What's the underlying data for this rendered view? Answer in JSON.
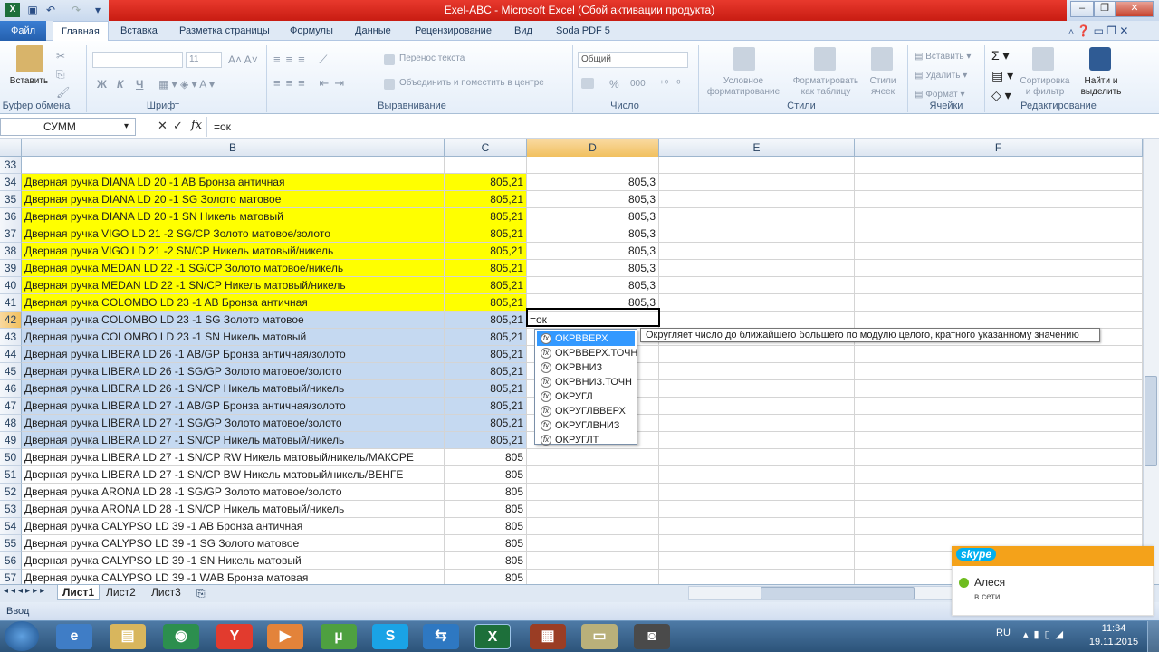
{
  "window": {
    "title": "Exel-ABC  -  Microsoft Excel (Сбой активации продукта)"
  },
  "tabs": [
    "Файл",
    "Главная",
    "Вставка",
    "Разметка страницы",
    "Формулы",
    "Данные",
    "Рецензирование",
    "Вид",
    "Soda PDF 5"
  ],
  "ribbon": {
    "paste": "Вставить",
    "font_size": "11",
    "bold": "Ж",
    "italic": "К",
    "underline": "Ч",
    "wrap_text": "Перенос текста",
    "merge_center": "Объединить и поместить в центре",
    "number_format": "Общий",
    "percent": "%",
    "thousands": "000",
    "conditional": "Условное",
    "conditional2": "форматирование",
    "as_table": "Форматировать",
    "as_table2": "как таблицу",
    "cell_styles": "Стили",
    "cell_styles2": "ячеек",
    "insert": "Вставить",
    "delete": "Удалить",
    "format": "Формат",
    "sort": "Сортировка",
    "sort2": "и фильтр",
    "find": "Найти и",
    "find2": "выделить",
    "groups": {
      "clipboard": "Буфер обмена",
      "font": "Шрифт",
      "alignment": "Выравнивание",
      "number": "Число",
      "styles": "Стили",
      "cells": "Ячейки",
      "editing": "Редактирование"
    }
  },
  "formula_bar": {
    "name_box": "СУММ",
    "fx": "fx",
    "formula": "=ок"
  },
  "columns": [
    "B",
    "C",
    "D",
    "E",
    "F"
  ],
  "rows": [
    {
      "n": "33",
      "b": "",
      "c": "",
      "d": "",
      "hl": ""
    },
    {
      "n": "34",
      "b": "Дверная ручка DIANA LD 20 -1 AB Бронза античная",
      "c": "805,21",
      "d": "805,3",
      "hl": "yl"
    },
    {
      "n": "35",
      "b": "Дверная ручка DIANA LD 20 -1 SG Золото матовое",
      "c": "805,21",
      "d": "805,3",
      "hl": "yl"
    },
    {
      "n": "36",
      "b": "Дверная ручка DIANA LD 20 -1 SN Никель матовый",
      "c": "805,21",
      "d": "805,3",
      "hl": "yl"
    },
    {
      "n": "37",
      "b": "Дверная ручка VIGO LD 21 -2 SG/CP Золото матовое/золото",
      "c": "805,21",
      "d": "805,3",
      "hl": "yl"
    },
    {
      "n": "38",
      "b": "Дверная ручка VIGO LD 21 -2 SN/CP Никель матовый/никель",
      "c": "805,21",
      "d": "805,3",
      "hl": "yl"
    },
    {
      "n": "39",
      "b": "Дверная ручка MEDAN LD 22 -1 SG/CP Золото матовое/никель",
      "c": "805,21",
      "d": "805,3",
      "hl": "yl"
    },
    {
      "n": "40",
      "b": "Дверная ручка MEDAN LD 22 -1 SN/CP Никель матовый/никель",
      "c": "805,21",
      "d": "805,3",
      "hl": "yl"
    },
    {
      "n": "41",
      "b": "Дверная ручка COLOMBO LD 23 -1 AB Бронза античная",
      "c": "805,21",
      "d": "805,3",
      "hl": "yl"
    },
    {
      "n": "42",
      "b": "Дверная ручка COLOMBO LD 23 -1 SG Золото матовое",
      "c": "805,21",
      "d": "=ок",
      "hl": "bl"
    },
    {
      "n": "43",
      "b": "Дверная ручка COLOMBO LD 23 -1 SN Никель матовый",
      "c": "805,21",
      "d": "",
      "hl": "bl"
    },
    {
      "n": "44",
      "b": "Дверная ручка LIBERA LD 26 -1 AB/GP Бронза античная/золото",
      "c": "805,21",
      "d": "",
      "hl": "bl"
    },
    {
      "n": "45",
      "b": "Дверная ручка LIBERA LD 26 -1 SG/GP Золото матовое/золото",
      "c": "805,21",
      "d": "",
      "hl": "bl"
    },
    {
      "n": "46",
      "b": "Дверная ручка LIBERA LD 26 -1 SN/CP Никель матовый/никель",
      "c": "805,21",
      "d": "",
      "hl": "bl"
    },
    {
      "n": "47",
      "b": "Дверная ручка LIBERA LD 27 -1 AB/GP Бронза античная/золото",
      "c": "805,21",
      "d": "",
      "hl": "bl"
    },
    {
      "n": "48",
      "b": "Дверная ручка LIBERA LD 27 -1 SG/GP Золото матовое/золото",
      "c": "805,21",
      "d": "",
      "hl": "bl"
    },
    {
      "n": "49",
      "b": "Дверная ручка LIBERA LD 27 -1 SN/CP Никель матовый/никель",
      "c": "805,21",
      "d": "",
      "hl": "bl"
    },
    {
      "n": "50",
      "b": "Дверная ручка LIBERA LD 27 -1 SN/CP RW Никель матовый/никель/МАКОРЕ",
      "c": "805",
      "d": "",
      "hl": ""
    },
    {
      "n": "51",
      "b": "Дверная ручка LIBERA LD 27 -1 SN/CP BW Никель матовый/никель/ВЕНГЕ",
      "c": "805",
      "d": "",
      "hl": ""
    },
    {
      "n": "52",
      "b": "Дверная ручка ARONA LD 28 -1 SG/GP Золото матовое/золото",
      "c": "805",
      "d": "",
      "hl": ""
    },
    {
      "n": "53",
      "b": "Дверная ручка ARONA LD 28 -1 SN/CP Никель матовый/никель",
      "c": "805",
      "d": "",
      "hl": ""
    },
    {
      "n": "54",
      "b": "Дверная ручка CALYPSO LD 39 -1 AB Бронза античная",
      "c": "805",
      "d": "",
      "hl": ""
    },
    {
      "n": "55",
      "b": "Дверная ручка CALYPSO LD 39 -1 SG Золото матовое",
      "c": "805",
      "d": "",
      "hl": ""
    },
    {
      "n": "56",
      "b": "Дверная ручка CALYPSO LD 39 -1 SN Никель матовый",
      "c": "805",
      "d": "",
      "hl": ""
    },
    {
      "n": "57",
      "b": "Дверная ручка CALYPSO LD 39 -1 WAB Бронза матовая",
      "c": "805",
      "d": "",
      "hl": ""
    }
  ],
  "autocomplete": [
    "ОКРВВЕРХ",
    "ОКРВВЕРХ.ТОЧН",
    "ОКРВНИЗ",
    "ОКРВНИЗ.ТОЧН",
    "ОКРУГЛ",
    "ОКРУГЛВВЕРХ",
    "ОКРУГЛВНИЗ",
    "ОКРУГЛТ"
  ],
  "tooltip": "Округляет число до ближайшего большего по модулю целого, кратного указанному значению",
  "sheets": [
    "Лист1",
    "Лист2",
    "Лист3"
  ],
  "status": "Ввод",
  "skype": {
    "brand": "skype",
    "name": "Алеся",
    "status": "в сети"
  },
  "tray": {
    "lang": "RU",
    "time": "11:34",
    "date": "19.11.2015"
  }
}
